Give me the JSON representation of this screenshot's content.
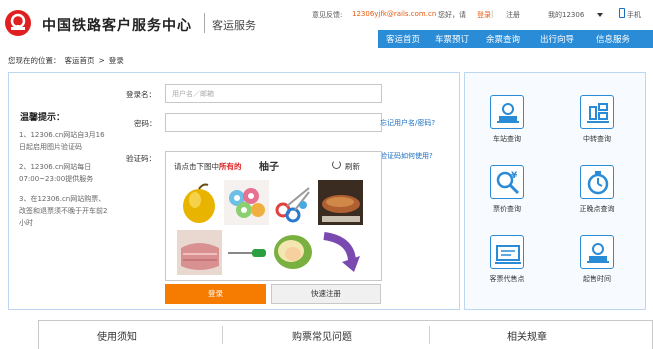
{
  "header": {
    "brand": "中国铁路客户服务中心",
    "brand_sub": "客运服务",
    "feedback_label": "意见反馈:",
    "feedback_email": "12306yjfk@rails.com.cn",
    "greeting": "您好，请",
    "login_link": "登录",
    "separator": "|",
    "register_link": "注册",
    "my_12306": "我的12306",
    "mobile": "手机",
    "nav": [
      "客运首页",
      "车票预订",
      "余票查询",
      "出行向导",
      "信息服务"
    ]
  },
  "breadcrumb": {
    "prefix": "您现在的位置：",
    "home": "客运首页",
    "arrow": ">",
    "current": "登录"
  },
  "tips": {
    "title": "温馨提示：",
    "items": [
      "1、12306.cn网站自3月16日起启用图片验证码",
      "2、12306.cn网站每日07:00~23:00提供服务",
      "3、在12306.cn网站购票、改签和退票须不晚于开车前2小时"
    ]
  },
  "form": {
    "username_label": "登录名：",
    "username_placeholder": "用户名／邮箱",
    "password_label": "密码：",
    "forgot_link": "忘记用户名/密码?",
    "captcha_label": "验证码：",
    "captcha_help_link": "验证码如何使用?",
    "captcha_prompt_prefix": "请点击下图中",
    "captcha_prompt_highlight": "所有的",
    "captcha_word": "柚子",
    "refresh_label": "刷新",
    "login_button": "登录",
    "quick_register_button": "快速注册"
  },
  "services": [
    {
      "label": "车站查询",
      "icon": "station-icon"
    },
    {
      "label": "中转查询",
      "icon": "transfer-icon"
    },
    {
      "label": "票价查询",
      "icon": "fare-icon"
    },
    {
      "label": "正晚点查询",
      "icon": "clock-icon"
    },
    {
      "label": "客票代售点",
      "icon": "ticket-agent-icon"
    },
    {
      "label": "起售时间",
      "icon": "sale-time-icon"
    }
  ],
  "bottom_tabs": [
    "使用须知",
    "购票常见问题",
    "相关规章"
  ],
  "colors": {
    "nav_blue": "#2a8bd6",
    "accent_orange": "#f57c00",
    "logo_red": "#e02020",
    "link_blue": "#1a6ec0"
  }
}
